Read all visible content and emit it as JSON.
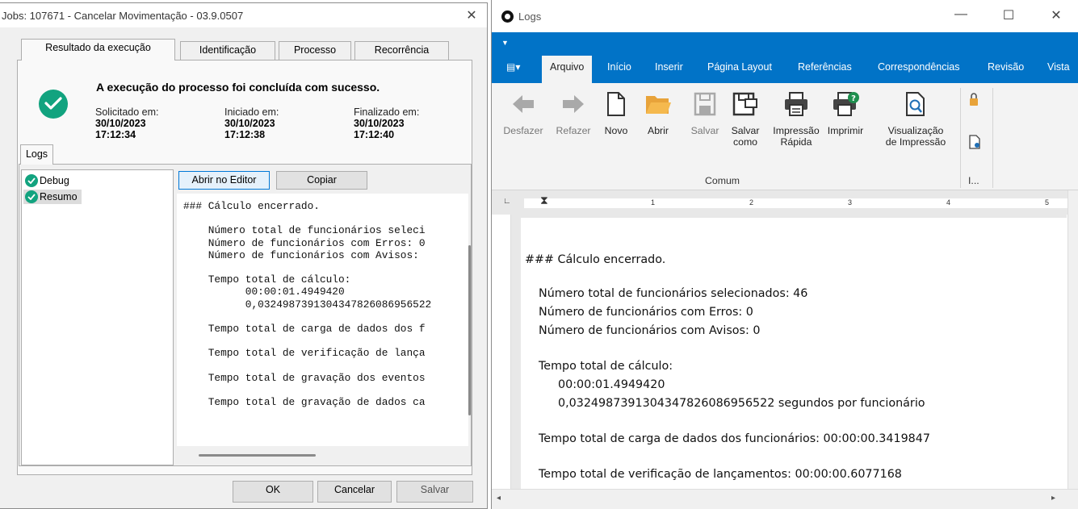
{
  "dialog": {
    "title": "Jobs: 107671 - Cancelar Movimentação - 03.9.0507",
    "close": "✕",
    "tabs": [
      "Resultado da execução",
      "Identificação",
      "Processo",
      "Recorrência"
    ],
    "message": "A execução do processo foi concluída com sucesso.",
    "solicitado_label": "Solicitado em:",
    "solicitado_date": "30/10/2023",
    "solicitado_time": "17:12:34",
    "iniciado_label": "Iniciado em:",
    "iniciado_date": "30/10/2023",
    "iniciado_time": "17:12:38",
    "finalizado_label": "Finalizado em:",
    "finalizado_date": "30/10/2023",
    "finalizado_time": "17:12:40",
    "logs_tab": "Logs",
    "tree": [
      "Debug",
      "Resumo"
    ],
    "open_editor": "Abrir no Editor",
    "copy": "Copiar",
    "log_text": "### Cálculo encerrado.\n\n    Número total de funcionários seleci\n    Número de funcionários com Erros: 0\n    Número de funcionários com Avisos: \n\n    Tempo total de cálculo:\n          00:00:01.4949420\n          0,0324987391304347826086956522\n\n    Tempo total de carga de dados dos f\n\n    Tempo total de verificação de lança\n\n    Tempo total de gravação dos eventos\n\n    Tempo total de gravação de dados ca",
    "ok": "OK",
    "cancel": "Cancelar",
    "save": "Salvar",
    "accent": "#12a37f"
  },
  "word": {
    "title": "Logs",
    "min": "—",
    "max": "☐",
    "close": "✕",
    "app_menu": "▤▾",
    "tabs": [
      "Arquivo",
      "Início",
      "Inserir",
      "Página Layout",
      "Referências",
      "Correspondências",
      "Revisão",
      "Vista"
    ],
    "items": {
      "undo": "Desfazer",
      "redo": "Refazer",
      "new": "Novo",
      "open": "Abrir",
      "save": "Salvar",
      "save_as_1": "Salvar",
      "save_as_2": "como",
      "quick_print_1": "Impressão",
      "quick_print_2": "Rápida",
      "print": "Imprimir",
      "preview_1": "Visualização",
      "preview_2": "de Impressão"
    },
    "group_common": "Comum",
    "group_short": "I...",
    "ruler_marks": [
      "1",
      "2",
      "3",
      "4",
      "5"
    ],
    "doc_lines": [
      "### Cálculo encerrado.",
      "Número total de funcionários selecionados: 46",
      "Número de funcionários com Erros: 0",
      "Número de funcionários com Avisos: 0",
      "Tempo total de cálculo:",
      "00:00:01.4949420",
      "0,0324987391304347826086956522 segundos por funcionário",
      "Tempo total de carga de dados dos funcionários: 00:00:00.3419847",
      "Tempo total de verificação de lançamentos: 00:00:00.6077168"
    ],
    "brand": "#0173c7"
  }
}
